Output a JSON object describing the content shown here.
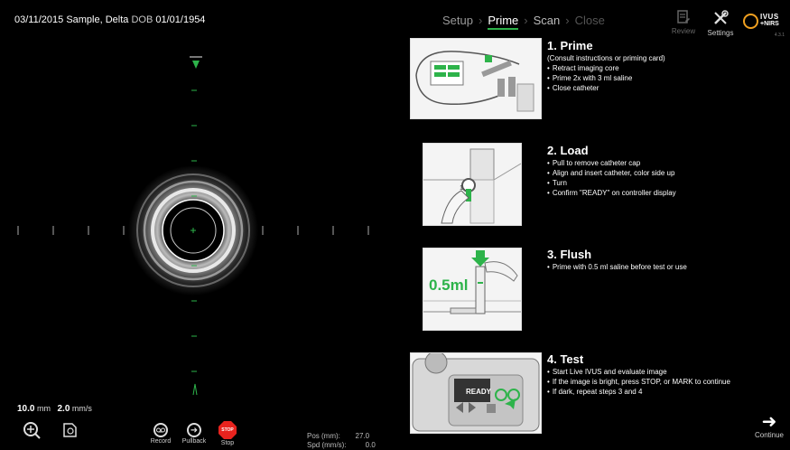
{
  "patient": {
    "date": "03/11/2015",
    "name": "Sample, Delta",
    "dob_label": "DOB",
    "dob": "01/01/1954"
  },
  "nav": {
    "steps": [
      "Setup",
      "Prime",
      "Scan",
      "Close"
    ],
    "current": "Prime",
    "sep": "›"
  },
  "header": {
    "review_label": "Review",
    "settings_label": "Settings",
    "brand_top": "IVUS",
    "brand_bottom": "+NIRS",
    "version": "4.3.1"
  },
  "instructions": [
    {
      "title": "1. Prime",
      "note": "(Consult instructions or priming card)",
      "bullets": [
        "Retract imaging core",
        "Prime 2x with 3 ml saline",
        "Close catheter"
      ]
    },
    {
      "title": "2. Load",
      "bullets": [
        "Pull to remove catheter cap",
        "Align and insert catheter, color side up",
        "Turn",
        "Confirm \"READY\" on controller display"
      ]
    },
    {
      "title": "3. Flush",
      "bullets": [
        "Prime with 0.5 ml saline before test or use"
      ]
    },
    {
      "title": "4. Test",
      "bullets": [
        "Start Live IVUS and evaluate image",
        "If the image is bright, press STOP, or MARK to continue",
        "If dark, repeat steps 3 and 4"
      ]
    }
  ],
  "illustrations": {
    "flush_volume": "0.5ml",
    "controller_display": "READY"
  },
  "measurements": {
    "depth": "10.0",
    "depth_unit": "mm",
    "speed": "2.0",
    "speed_unit": "mm/s"
  },
  "controls": {
    "record": "Record",
    "pullback": "Pullback",
    "stop": "Stop",
    "stop_icon_text": "STOP"
  },
  "position": {
    "pos_label": "Pos (mm):",
    "pos_value": "27.0",
    "spd_label": "Spd (mm/s):",
    "spd_value": "0.0"
  },
  "continue_label": "Continue",
  "colors": {
    "accent": "#2db34a",
    "stop": "#e8231e",
    "brand": "#f0a020"
  }
}
